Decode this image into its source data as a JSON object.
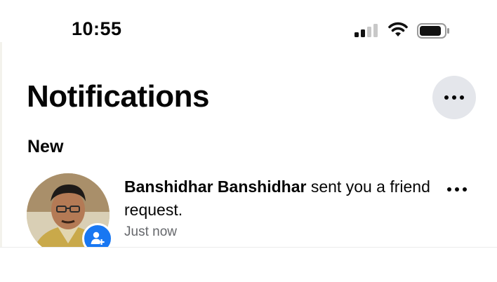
{
  "status_bar": {
    "time": "10:55"
  },
  "header": {
    "title": "Notifications"
  },
  "sections": [
    {
      "label": "New"
    }
  ],
  "notification": {
    "name": "Banshidhar Banshidhar",
    "message": " sent you a friend request.",
    "time": "Just now"
  },
  "colors": {
    "badge": "#1877f2",
    "secondary_text": "#65676b",
    "header_button_bg": "#e4e6eb"
  },
  "icons": [
    "signal-icon",
    "wifi-icon",
    "battery-icon",
    "more-icon",
    "add-friend-icon"
  ]
}
